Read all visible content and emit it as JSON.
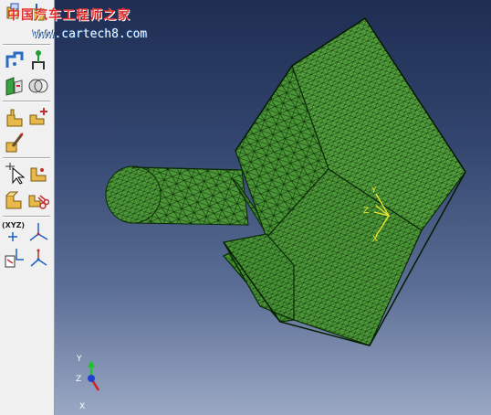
{
  "watermark": {
    "title": "中国汽车工程师之家",
    "url": "www.cartech8.com"
  },
  "toolbox": {
    "xyz_label": "(XYZ)",
    "tools": [
      {
        "name": "create-part-tool",
        "icon": "part-icon"
      },
      {
        "name": "part-manager-tool",
        "icon": "part-manager-icon"
      },
      {
        "name": "create-datum-tool",
        "icon": "datum-icon"
      },
      {
        "name": "datum-point-tool",
        "icon": "datum-point-icon"
      },
      {
        "name": "partition-tool",
        "icon": "partition-icon"
      },
      {
        "name": "boolean-tool",
        "icon": "boolean-icon"
      },
      {
        "name": "mesh-part-tool",
        "icon": "mesh-part-icon"
      },
      {
        "name": "seed-part-tool",
        "icon": "seed-icon"
      },
      {
        "name": "verify-mesh-tool",
        "icon": "verify-mesh-icon"
      },
      {
        "name": "query-tool",
        "icon": "select-cursor-icon"
      },
      {
        "name": "edit-mesh-tool",
        "icon": "edit-mesh-icon"
      },
      {
        "name": "create-element-tool",
        "icon": "element-icon"
      },
      {
        "name": "delete-tool",
        "icon": "scissors-icon"
      },
      {
        "name": "create-node-tool",
        "icon": "node-xyz-icon"
      },
      {
        "name": "csys-tool",
        "icon": "csys-icon"
      },
      {
        "name": "offset-tool",
        "icon": "offset-icon"
      },
      {
        "name": "transform-tool",
        "icon": "transform-icon"
      }
    ]
  },
  "triad": {
    "y_label": "Y",
    "z_label": "Z",
    "x_label": "X"
  },
  "local_csys": {
    "y_label": "Y",
    "z_label": "Z",
    "x_label": "X"
  },
  "colors": {
    "mesh_fill": "#4f9c3a",
    "mesh_lines": "#0b2a06",
    "viewport_top": "#1e2d52",
    "viewport_bottom": "#9aa8c4",
    "csys": "#f2e830"
  }
}
